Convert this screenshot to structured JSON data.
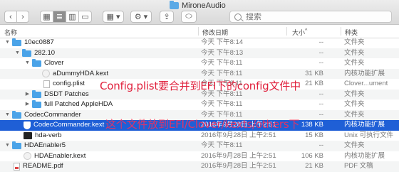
{
  "window": {
    "title": "MironeAudio"
  },
  "toolbar": {
    "back": "‹",
    "forward": "›",
    "view_icons": "▦",
    "view_list": "≣",
    "view_columns": "▥",
    "view_gallery": "▭",
    "arrange": "▦ ▾",
    "action": "⚙ ▾",
    "share": "⇪",
    "tags": "⬭"
  },
  "search": {
    "placeholder": "搜索"
  },
  "columns": {
    "name": "名称",
    "date": "修改日期",
    "size": "大小",
    "kind": "种类"
  },
  "rows": [
    {
      "name": "10ec0887",
      "date": "今天 下午8:14",
      "size": "--",
      "kind": "文件夹"
    },
    {
      "name": "282.10",
      "date": "今天 下午8:13",
      "size": "--",
      "kind": "文件夹"
    },
    {
      "name": "Clover",
      "date": "今天 下午8:11",
      "size": "--",
      "kind": "文件夹"
    },
    {
      "name": "aDummyHDA.kext",
      "date": "今天 下午8:11",
      "size": "31 KB",
      "kind": "内核功能扩展"
    },
    {
      "name": "config.plist",
      "date": "今天 下午8:11",
      "size": "21 KB",
      "kind": "Clover...ument"
    },
    {
      "name": "DSDT Patches",
      "date": "今天 下午8:11",
      "size": "--",
      "kind": "文件夹"
    },
    {
      "name": "full Patched AppleHDA",
      "date": "今天 下午8:11",
      "size": "--",
      "kind": "文件夹"
    },
    {
      "name": "CodecCommander",
      "date": "今天 下午8:11",
      "size": "--",
      "kind": "文件夹"
    },
    {
      "name": "CodecCommander.kext",
      "date": "2016年9月28日 上午2:51",
      "size": "138 KB",
      "kind": "内核功能扩展"
    },
    {
      "name": "hda-verb",
      "date": "2016年9月28日 上午2:51",
      "size": "15 KB",
      "kind": "Unix 可执行文件"
    },
    {
      "name": "HDAEnabler5",
      "date": "今天 下午8:11",
      "size": "--",
      "kind": "文件夹"
    },
    {
      "name": "HDAEnabler.kext",
      "date": "2016年9月28日 上午2:51",
      "size": "106 KB",
      "kind": "内核功能扩展"
    },
    {
      "name": "README.pdf",
      "date": "2016年9月28日 上午2:51",
      "size": "21 KB",
      "kind": "PDF 文稿"
    }
  ],
  "annotations": {
    "config_note": "Config.plist要合并到EFI下的config文件中",
    "kext_note": "这个文件放到EFI/Clover/kexts/others下"
  },
  "colors": {
    "selection": "#1f5fd6",
    "folder": "#4aa3e8",
    "annotation": "#e0203c"
  }
}
